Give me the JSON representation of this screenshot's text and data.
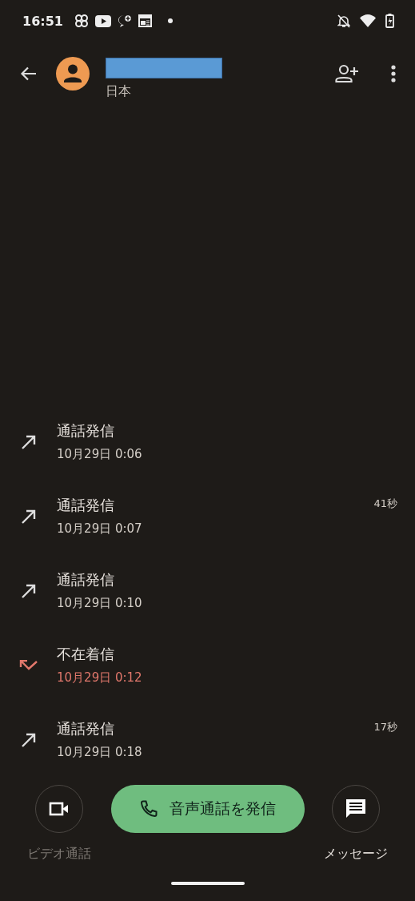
{
  "status_bar": {
    "time": "16:51"
  },
  "header": {
    "subtitle": "日本",
    "redacted_name": true
  },
  "calls": [
    {
      "kind": "outgoing",
      "title": "通話発信",
      "time": "10月29日 0:06"
    },
    {
      "kind": "outgoing",
      "title": "通話発信",
      "time": "10月29日 0:07",
      "duration": "41秒"
    },
    {
      "kind": "outgoing",
      "title": "通話発信",
      "time": "10月29日 0:10"
    },
    {
      "kind": "missed",
      "title": "不在着信",
      "time": "10月29日 0:12"
    },
    {
      "kind": "outgoing",
      "title": "通話発信",
      "time": "10月29日 0:18",
      "duration": "17秒"
    }
  ],
  "actions": {
    "video": {
      "label": "ビデオ通話",
      "disabled": true
    },
    "call": {
      "label": "音声通話を発信"
    },
    "message": {
      "label": "メッセージ",
      "disabled": false
    }
  }
}
